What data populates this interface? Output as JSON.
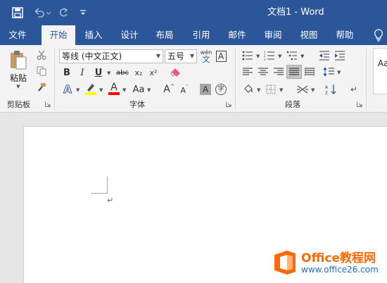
{
  "window": {
    "title": "文档1  -  Word"
  },
  "tabs": [
    {
      "label": "文件"
    },
    {
      "label": "开始"
    },
    {
      "label": "插入"
    },
    {
      "label": "设计"
    },
    {
      "label": "布局"
    },
    {
      "label": "引用"
    },
    {
      "label": "邮件"
    },
    {
      "label": "审阅"
    },
    {
      "label": "视图"
    },
    {
      "label": "帮助"
    }
  ],
  "active_tab": "开始",
  "ribbon": {
    "clipboard": {
      "paste_label": "粘贴",
      "group_label": "剪贴板"
    },
    "font": {
      "font_name": "等线 (中文正文)",
      "font_size": "五号",
      "bold": "B",
      "italic": "I",
      "underline": "U",
      "strike": "abc",
      "subscript": "x₂",
      "superscript": "x²",
      "text_effects": "A",
      "font_color": "A",
      "change_case": "Aa",
      "grow": "A",
      "shrink": "A",
      "shade": "A",
      "enclose": "字",
      "phonetic": "wén",
      "phonetic_char": "文",
      "border_char": "A",
      "group_label": "字体"
    },
    "paragraph": {
      "group_label": "段落"
    },
    "styles": {
      "preview": "AaBbCcDd"
    }
  },
  "document": {
    "paragraph_mark": "↵"
  },
  "watermark": {
    "name": "Office教程网",
    "url": "www.office26.com"
  },
  "colors": {
    "brand": "#2b579a",
    "highlight": "#ffff00",
    "font_red": "#ff0000",
    "logo_orange": "#ff6a00",
    "logo_blue": "#1a6fc4"
  }
}
